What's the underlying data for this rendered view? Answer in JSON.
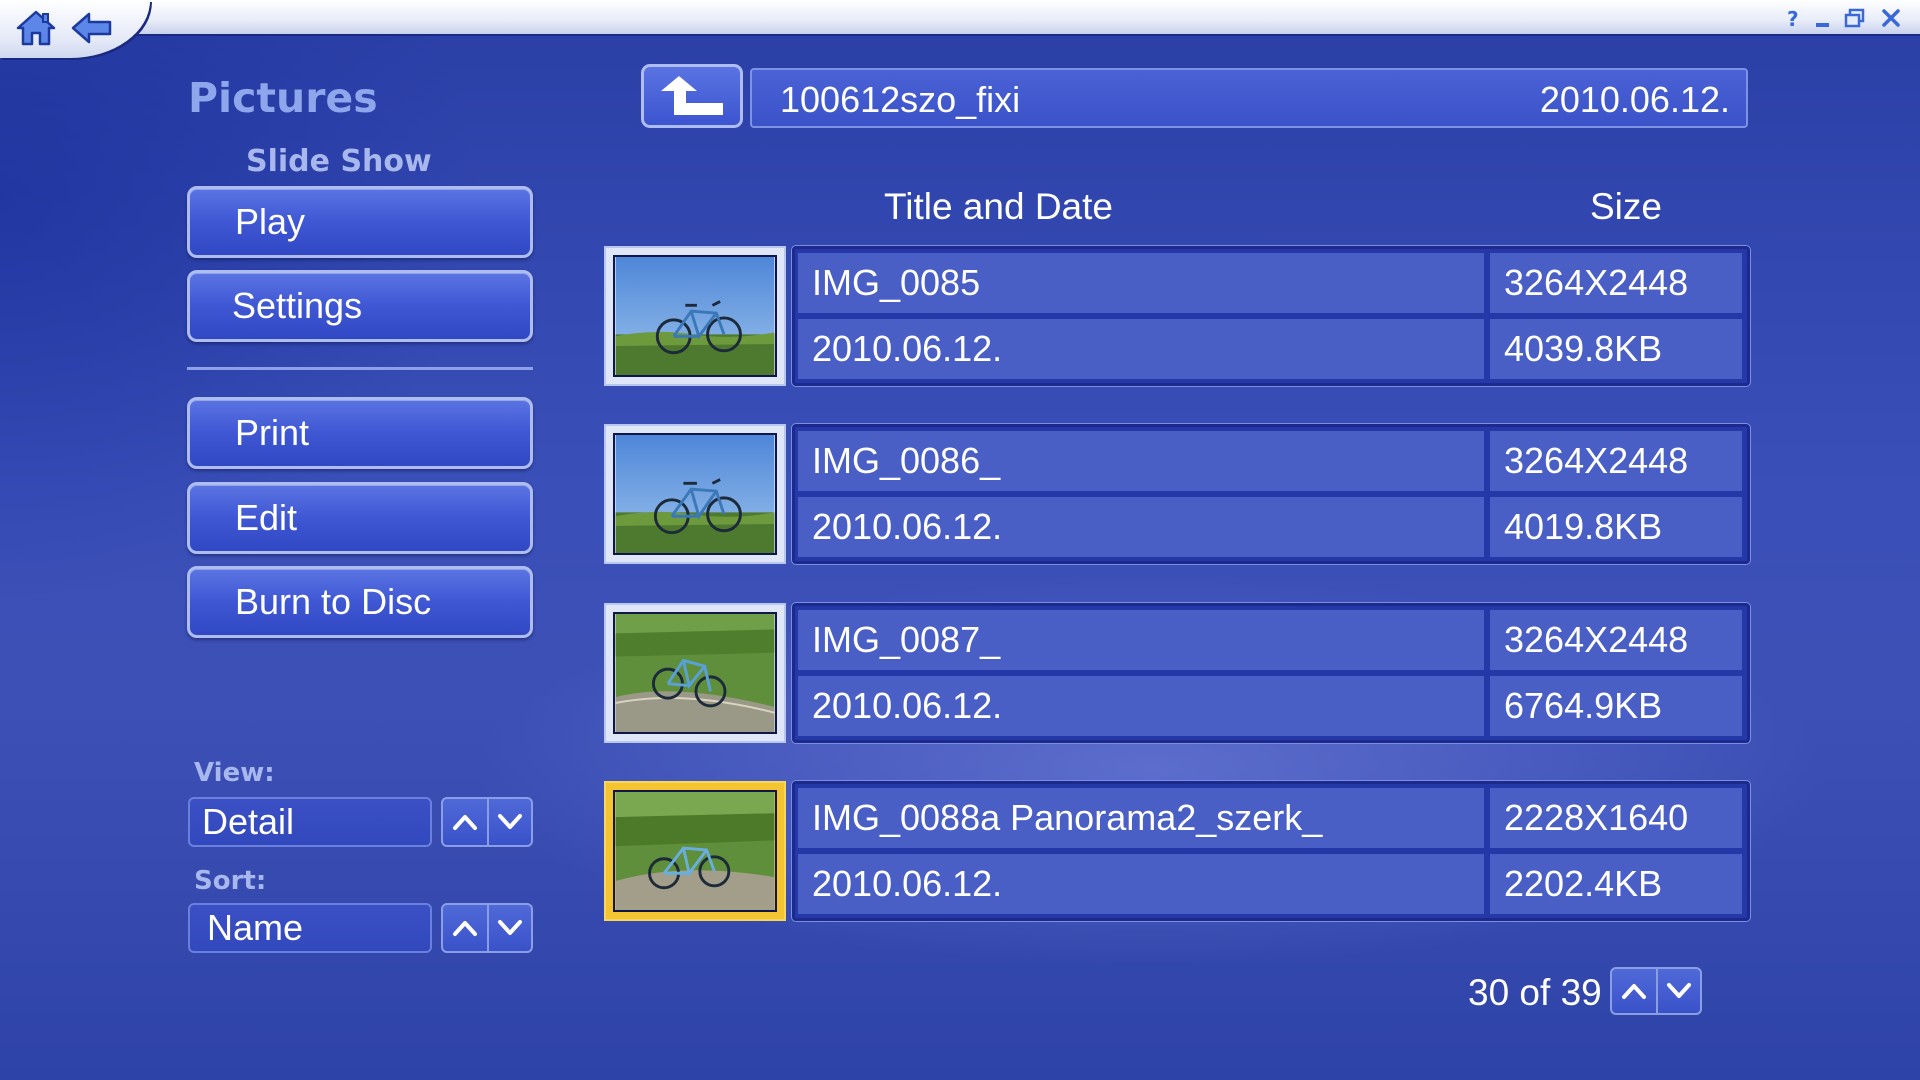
{
  "left_panel": {
    "title": "Pictures",
    "section_label": "Slide Show",
    "buttons": {
      "play": "Play",
      "settings": "Settings",
      "print": "Print",
      "edit": "Edit",
      "burn": "Burn to Disc"
    },
    "view": {
      "label": "View:",
      "value": "Detail"
    },
    "sort": {
      "label": "Sort:",
      "value": "Name"
    }
  },
  "header": {
    "folder_name": "100612szo_fixi",
    "folder_date": "2010.06.12."
  },
  "columns": {
    "title_date": "Title and Date",
    "size": "Size"
  },
  "rows": [
    {
      "title": "IMG_0085",
      "date": "2010.06.12.",
      "dimensions": "3264X2448",
      "size": "4039.8KB",
      "selected": false
    },
    {
      "title": "IMG_0086_",
      "date": "2010.06.12.",
      "dimensions": "3264X2448",
      "size": "4019.8KB",
      "selected": false
    },
    {
      "title": "IMG_0087_",
      "date": "2010.06.12.",
      "dimensions": "3264X2448",
      "size": "6764.9KB",
      "selected": false
    },
    {
      "title": "IMG_0088a Panorama2_szerk_",
      "date": "2010.06.12.",
      "dimensions": "2228X1640",
      "size": "2202.4KB",
      "selected": true
    }
  ],
  "pager": {
    "text": "30 of 39"
  },
  "colors": {
    "accent_title": "#8ea6ec",
    "selection": "#f4c531",
    "background": "#3a4fb8"
  },
  "icons": {
    "home": "home-icon",
    "back": "back-arrow-icon",
    "help": "help-icon",
    "minimize": "minimize-icon",
    "restore": "restore-icon",
    "close": "close-icon",
    "up_folder": "up-folder-arrow-icon"
  }
}
